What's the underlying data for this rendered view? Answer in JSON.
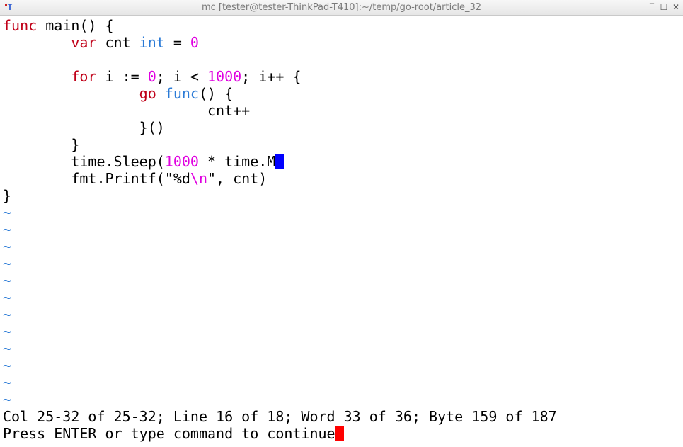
{
  "window": {
    "title": "mc [tester@tester-ThinkPad-T410]:~/temp/go-root/article_32",
    "icon": "terminal-app-icon",
    "buttons": {
      "minimize": "‾",
      "maximize": "☐",
      "close": "✕"
    }
  },
  "editor": {
    "code": {
      "l1_kw": "func",
      "l1_rest": " main() {",
      "l2_indent": "        ",
      "l2_kw": "var",
      "l2_mid": " cnt ",
      "l2_type": "int",
      "l2_eq": " = ",
      "l2_num": "0",
      "l4_indent": "        ",
      "l4_kw": "for",
      "l4_a": " i := ",
      "l4_num0": "0",
      "l4_b": "; i < ",
      "l4_num1000": "1000",
      "l4_c": "; i++ {",
      "l5_indent": "                ",
      "l5_go": "go",
      "l5_sp": " ",
      "l5_func": "func",
      "l5_rest": "() {",
      "l6_indent": "                        ",
      "l6_text": "cnt++",
      "l7_indent": "                ",
      "l7_text": "}()",
      "l8_indent": "        ",
      "l8_text": "}",
      "l9_indent": "        ",
      "l9_a": "time.Sleep(",
      "l9_num": "1000",
      "l9_b": " * time.M",
      "l10_indent": "        ",
      "l10_a": "fmt.Printf(\"%d",
      "l10_esc": "\\n",
      "l10_b": "\", cnt)",
      "l11_text": "}"
    },
    "empty_line_marker": "~",
    "empty_lines": 12
  },
  "status": {
    "position_info": "Col 25-32 of 25-32; Line 16 of 18; Word 33 of 36; Byte 159 of 187",
    "prompt": "Press ENTER or type command to continue"
  },
  "colors": {
    "keyword": "#c00018",
    "type": "#2a7ad6",
    "number": "#e000e0",
    "edit_cursor": "#0000ff",
    "prompt_cursor": "#ff0000"
  }
}
